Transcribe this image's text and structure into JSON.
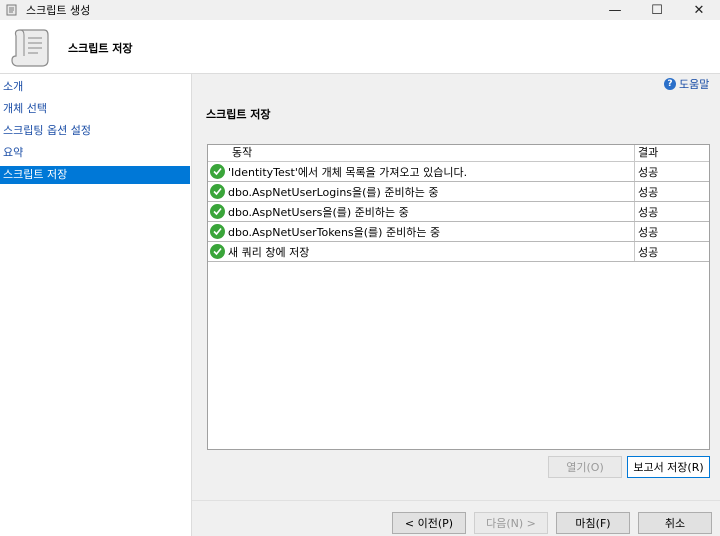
{
  "window": {
    "title": "스크립트 생성",
    "minimize": "—",
    "maximize": "☐",
    "close": "✕"
  },
  "header": {
    "title": "스크립트 저장",
    "icon": "scroll-icon"
  },
  "sidebar": {
    "items": [
      {
        "label": "소개"
      },
      {
        "label": "개체 선택"
      },
      {
        "label": "스크립팅 옵션 설정"
      },
      {
        "label": "요약"
      },
      {
        "label": "스크립트 저장",
        "active": true
      }
    ]
  },
  "help": {
    "label": "도움말",
    "icon": "?"
  },
  "main": {
    "section_title": "스크립트 저장",
    "columns": {
      "action": "동작",
      "result": "결과"
    },
    "rows": [
      {
        "action": "'IdentityTest'에서 개체 목록을 가져오고 있습니다.",
        "result": "성공"
      },
      {
        "action": "dbo.AspNetUserLogins을(를) 준비하는 중",
        "result": "성공"
      },
      {
        "action": "dbo.AspNetUsers을(를) 준비하는 중",
        "result": "성공"
      },
      {
        "action": "dbo.AspNetUserTokens을(를) 준비하는 중",
        "result": "성공"
      },
      {
        "action": "새 쿼리 창에 저장",
        "result": "성공"
      }
    ]
  },
  "buttons": {
    "open": "열기(O)",
    "save_report": "보고서 저장(R)",
    "previous": "< 이전(P)",
    "next": "다음(N) >",
    "finish": "마침(F)",
    "cancel": "취소"
  },
  "colors": {
    "accent": "#0078d7",
    "link": "#1a4da6",
    "success": "#3aa53a"
  }
}
